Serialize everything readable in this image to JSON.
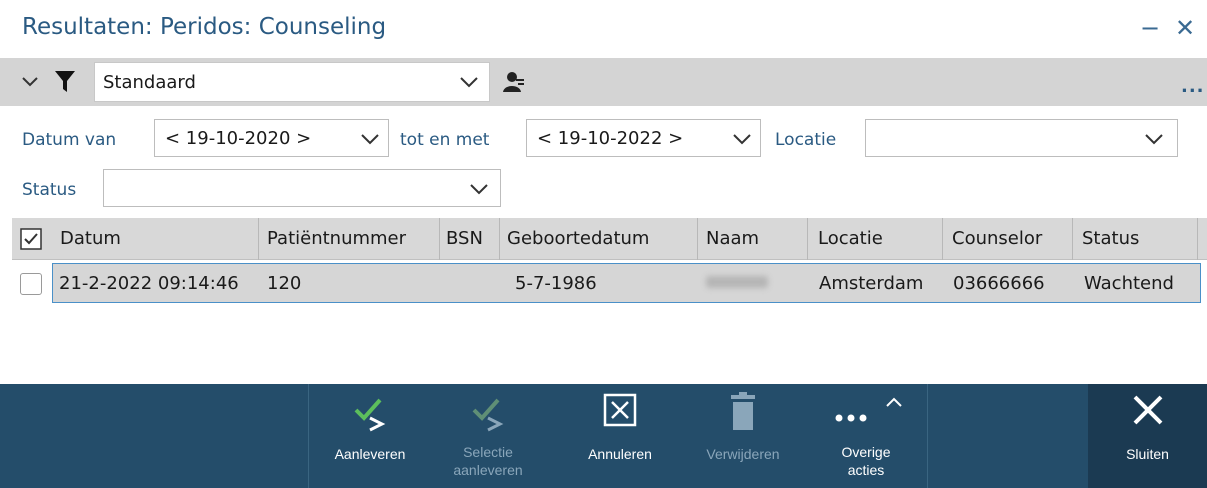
{
  "window": {
    "title": "Resultaten: Peridos: Counseling",
    "minimize": "−",
    "close": "✕"
  },
  "filterbar": {
    "selected_filter": "Standaard",
    "more": "..."
  },
  "params": {
    "datum_van_label": "Datum van",
    "datum_van_value": "< 19-10-2020 >",
    "tot_en_met_label": "tot en met",
    "tot_en_met_value": "< 19-10-2022 >",
    "locatie_label": "Locatie",
    "locatie_value": "",
    "status_label": "Status",
    "status_value": ""
  },
  "table": {
    "columns": [
      "Datum",
      "Patiëntnummer",
      "BSN",
      "Geboortedatum",
      "Naam",
      "Locatie",
      "Counselor",
      "Status"
    ],
    "rows": [
      {
        "datum": "21-2-2022 09:14:46",
        "patientnummer": "120",
        "bsn": "",
        "geboortedatum": "5-7-1986",
        "naam": "",
        "locatie": "Amsterdam",
        "counselor": "03666666",
        "status": "Wachtend"
      }
    ]
  },
  "actions": {
    "aanleveren": "Aanleveren",
    "selectie_aanleveren_1": "Selectie",
    "selectie_aanleveren_2": "aanleveren",
    "annuleren": "Annuleren",
    "verwijderen": "Verwijderen",
    "overige_1": "Overige",
    "overige_2": "acties",
    "sluiten": "Sluiten"
  },
  "colors": {
    "accent": "#2a5a82",
    "actionbar": "#244d6a",
    "check_green": "#4caf50"
  }
}
